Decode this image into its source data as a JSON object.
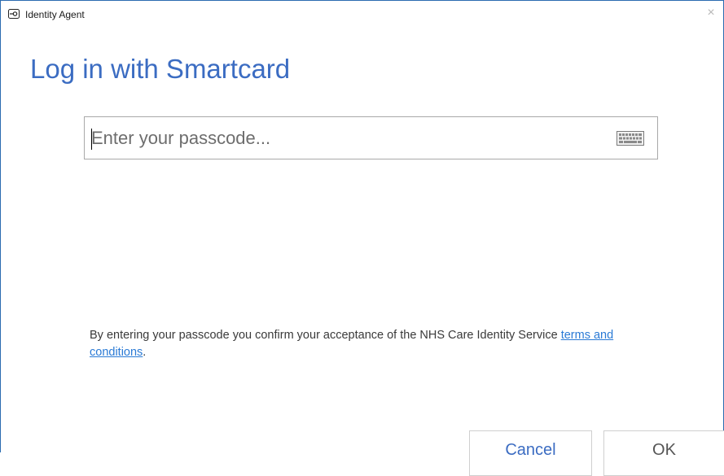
{
  "window": {
    "title": "Identity Agent",
    "close_glyph": "×"
  },
  "heading": "Log in with Smartcard",
  "passcode": {
    "placeholder": "Enter your passcode...",
    "value": "",
    "keyboard_icon": "keyboard-icon"
  },
  "notice": {
    "text_before": "By entering your passcode you confirm your acceptance of the NHS Care Identity Service ",
    "link_text": "terms and conditions",
    "text_after": "."
  },
  "buttons": {
    "cancel": "Cancel",
    "ok": "OK"
  },
  "colors": {
    "accent": "#3b6cc2",
    "link": "#2a7ad5",
    "border": "#2b6cb0"
  }
}
